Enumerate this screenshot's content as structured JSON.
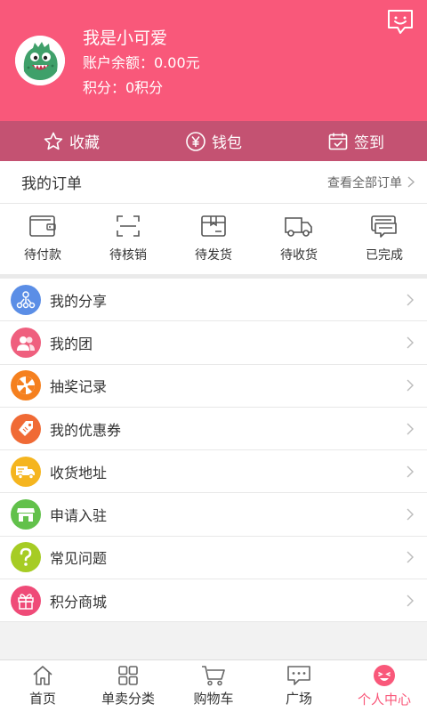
{
  "profile": {
    "name": "我是小可爱",
    "balance": "账户余额：0.00元",
    "points": "积分：0积分"
  },
  "quickbar": {
    "favorites": "收藏",
    "wallet": "钱包",
    "checkin": "签到"
  },
  "orders": {
    "title": "我的订单",
    "view_all": "查看全部订单",
    "items": [
      {
        "label": "待付款",
        "icon": "wallet-icon"
      },
      {
        "label": "待核销",
        "icon": "scan-icon"
      },
      {
        "label": "待发货",
        "icon": "package-icon"
      },
      {
        "label": "待收货",
        "icon": "truck-icon"
      },
      {
        "label": "已完成",
        "icon": "chat-cards-icon"
      }
    ]
  },
  "menu": [
    {
      "label": "我的分享",
      "icon": "share-icon",
      "color": "#5b8ee6"
    },
    {
      "label": "我的团",
      "icon": "group-icon",
      "color": "#ef5f7e"
    },
    {
      "label": "抽奖记录",
      "icon": "lottery-wheel-icon",
      "color": "#f5801f"
    },
    {
      "label": "我的优惠券",
      "icon": "coupon-tag-icon",
      "color": "#f06a35"
    },
    {
      "label": "收货地址",
      "icon": "delivery-truck-icon",
      "color": "#f5b51f"
    },
    {
      "label": "申请入驻",
      "icon": "store-icon",
      "color": "#62c14b"
    },
    {
      "label": "常见问题",
      "icon": "question-icon",
      "color": "#a6cc24"
    },
    {
      "label": "积分商城",
      "icon": "gift-icon",
      "color": "#ef4b78"
    }
  ],
  "nav": {
    "home": "首页",
    "category": "单卖分类",
    "cart": "购物车",
    "plaza": "广场",
    "profile": "个人中心"
  },
  "colors": {
    "header_bg": "#f9587a",
    "quickbar_bg": "#c45272",
    "accent": "#f9587a"
  }
}
